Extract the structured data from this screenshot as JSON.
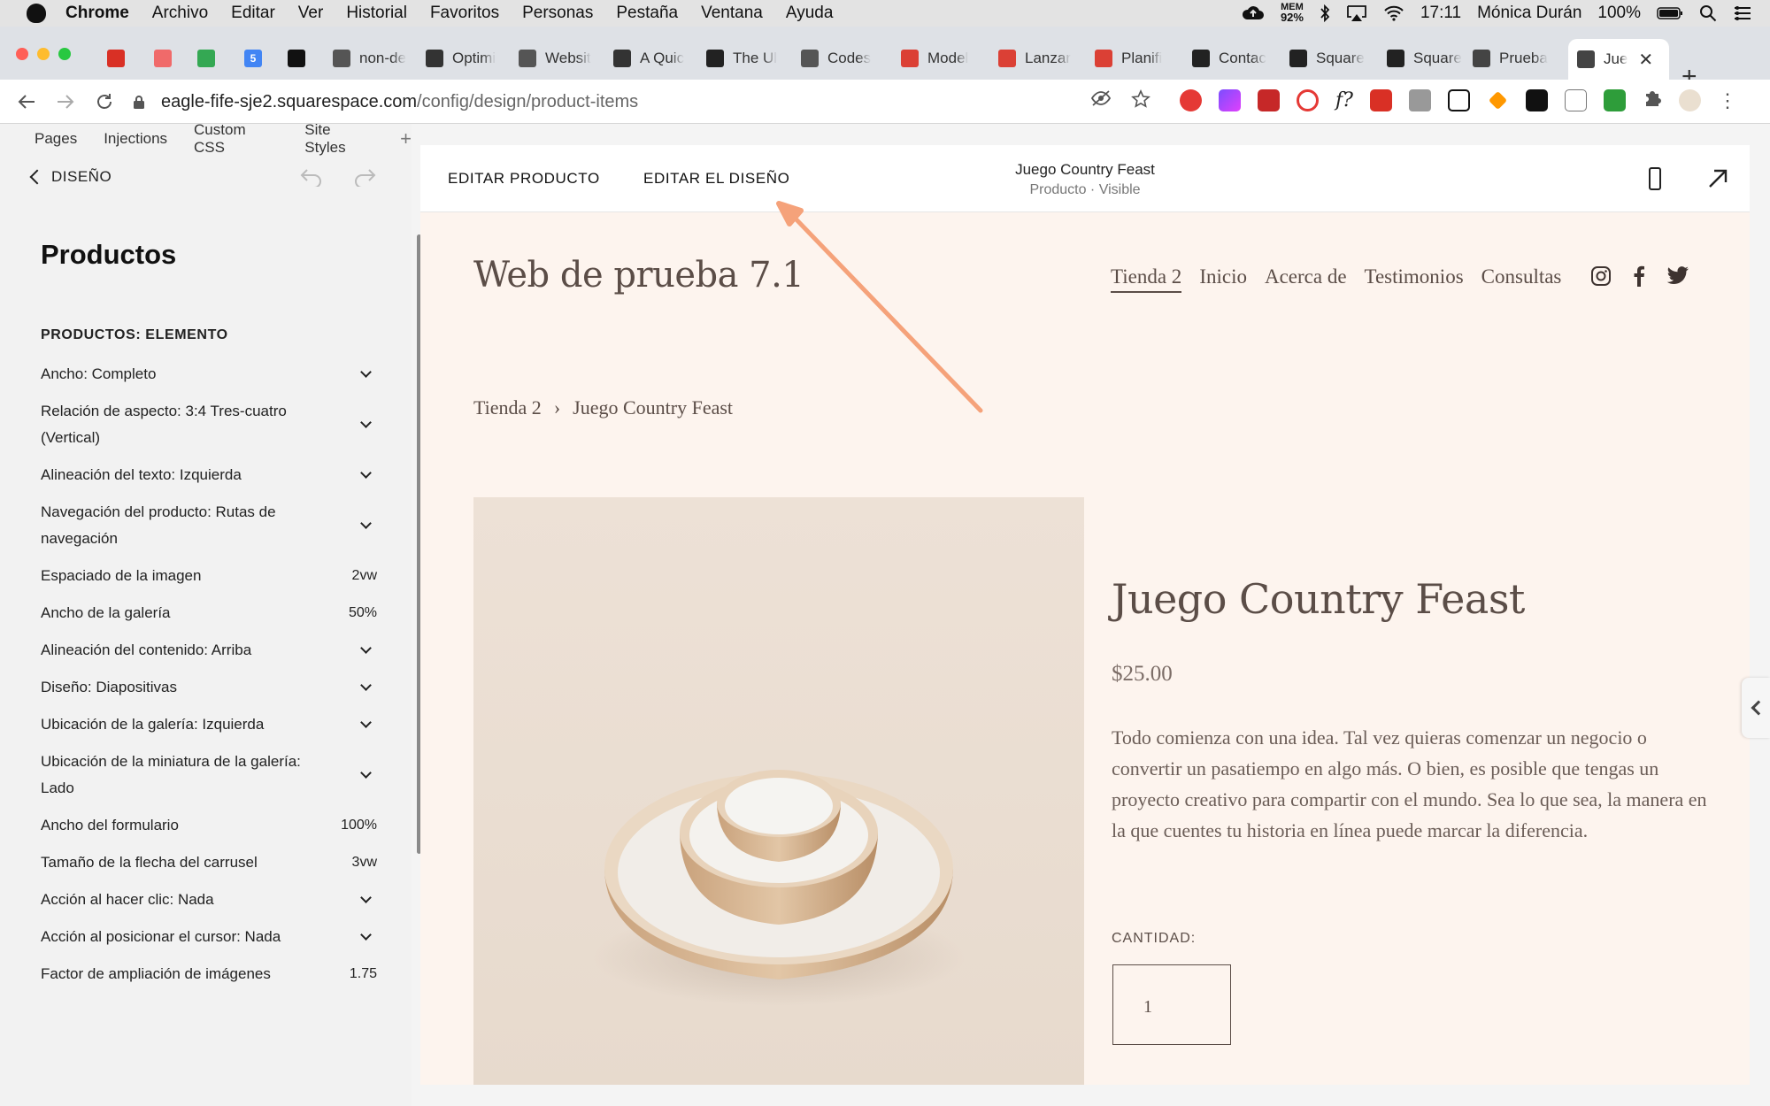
{
  "menubar": {
    "app": "Chrome",
    "items": [
      "Archivo",
      "Editar",
      "Ver",
      "Historial",
      "Favoritos",
      "Personas",
      "Pestaña",
      "Ventana",
      "Ayuda"
    ],
    "mem_label": "MEM",
    "mem_value": "92%",
    "time": "17:11",
    "user": "Mónica Durán",
    "battery": "100%"
  },
  "tabs": [
    {
      "title": "",
      "icon": "gmail-icon",
      "color": "#d93025"
    },
    {
      "title": "",
      "icon": "asana-icon",
      "color": "#f06a6a"
    },
    {
      "title": "",
      "icon": "drive-icon",
      "color": "#34a853"
    },
    {
      "title": "",
      "icon": "calendar-icon",
      "color": "#4285f4",
      "badge": "5"
    },
    {
      "title": "",
      "icon": "notion-icon",
      "color": "#111111"
    },
    {
      "title": "non-de",
      "icon": "globe-icon",
      "color": "#555555"
    },
    {
      "title": "Optimi",
      "icon": "doc-icon",
      "color": "#333333"
    },
    {
      "title": "Websit",
      "icon": "globe-icon",
      "color": "#555555"
    },
    {
      "title": "A Quic",
      "icon": "doc-icon",
      "color": "#333333"
    },
    {
      "title": "The Ul",
      "icon": "heart-icon",
      "color": "#222222"
    },
    {
      "title": "Codes",
      "icon": "globe-icon",
      "color": "#555555"
    },
    {
      "title": "Model",
      "icon": "todoist-icon",
      "color": "#db4035"
    },
    {
      "title": "Lanzar",
      "icon": "todoist-icon",
      "color": "#db4035"
    },
    {
      "title": "Planifi",
      "icon": "todoist-icon",
      "color": "#db4035"
    },
    {
      "title": "Contac",
      "icon": "squarespace-icon",
      "color": "#222222"
    },
    {
      "title": "Square",
      "icon": "squarespace-icon",
      "color": "#222222"
    },
    {
      "title": "Square",
      "icon": "squarespace-wave-icon",
      "color": "#222222"
    },
    {
      "title": "Prueba",
      "icon": "cube-icon",
      "color": "#444444"
    }
  ],
  "active_tab": {
    "title": "Jue",
    "icon": "cube-icon"
  },
  "address": {
    "host": "eagle-fife-sje2.squarespace.com",
    "path": "/config/design/product-items"
  },
  "sidebar": {
    "tabs": [
      "Pages",
      "Injections",
      "Custom CSS",
      "Site Styles"
    ],
    "add_tab": "+",
    "back_label": "DISEÑO",
    "title": "Productos",
    "section": "PRODUCTOS: ELEMENTO",
    "rows": [
      {
        "label": "Ancho: Completo",
        "value": "",
        "dropdown": true
      },
      {
        "label": "Relación de aspecto: 3:4 Tres-cuatro (Vertical)",
        "value": "",
        "dropdown": true
      },
      {
        "label": "Alineación del texto: Izquierda",
        "value": "",
        "dropdown": true
      },
      {
        "label": "Navegación del producto: Rutas de navegación",
        "value": "",
        "dropdown": true
      },
      {
        "label": "Espaciado de la imagen",
        "value": "2vw",
        "dropdown": false
      },
      {
        "label": "Ancho de la galería",
        "value": "50%",
        "dropdown": false
      },
      {
        "label": "Alineación del contenido: Arriba",
        "value": "",
        "dropdown": true
      },
      {
        "label": "Diseño: Diapositivas",
        "value": "",
        "dropdown": true
      },
      {
        "label": "Ubicación de la galería: Izquierda",
        "value": "",
        "dropdown": true
      },
      {
        "label": "Ubicación de la miniatura de la galería: Lado",
        "value": "",
        "dropdown": true
      },
      {
        "label": "Ancho del formulario",
        "value": "100%",
        "dropdown": false
      },
      {
        "label": "Tamaño de la flecha del carrusel",
        "value": "3vw",
        "dropdown": false
      },
      {
        "label": "Acción al hacer clic: Nada",
        "value": "",
        "dropdown": true
      },
      {
        "label": "Acción al posicionar el cursor: Nada",
        "value": "",
        "dropdown": true
      },
      {
        "label": "Factor de ampliación de imágenes",
        "value": "1.75",
        "dropdown": false
      }
    ]
  },
  "editor": {
    "edit_product": "EDITAR PRODUCTO",
    "edit_design": "EDITAR EL DISEÑO",
    "page_name": "Juego Country Feast",
    "page_status": "Producto · Visible"
  },
  "site": {
    "title": "Web de prueba 7.1",
    "nav": [
      "Tienda 2",
      "Inicio",
      "Acerca de",
      "Testimonios",
      "Consultas"
    ],
    "breadcrumb": [
      "Tienda 2",
      "›",
      "Juego Country Feast"
    ],
    "product": {
      "name": "Juego Country Feast",
      "price": "$25.00",
      "description": "Todo comienza con una idea. Tal vez quieras comenzar un negocio o convertir un pasatiempo en algo más. O bien, es posible que tengas un proyecto creativo para compartir con el mundo. Sea lo que sea, la manera en la que cuentes tu historia en línea puede marcar la diferencia.",
      "quantity_label": "CANTIDAD:",
      "quantity": "1"
    }
  },
  "colors": {
    "annotation_arrow": "#f5a27a",
    "preview_bg": "#fdf4ee",
    "site_text": "#5b4d47"
  }
}
